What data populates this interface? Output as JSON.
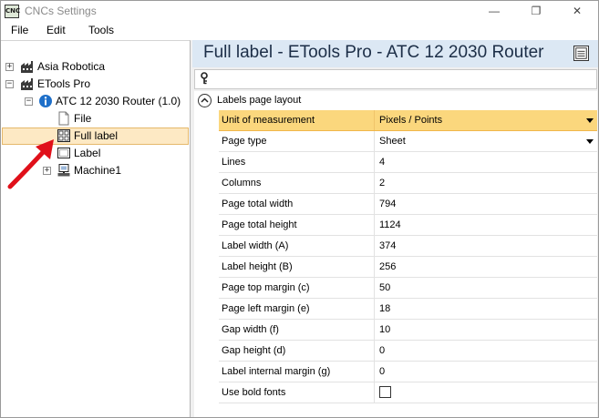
{
  "window": {
    "title": "CNCs Settings",
    "app_icon_text": "CNC",
    "minimize": "—",
    "maximize": "❐",
    "close": "✕"
  },
  "menu": [
    "File",
    "Edit",
    "Tools"
  ],
  "tree": {
    "nodes": [
      {
        "label": "Asia Robotica",
        "expander": "+",
        "icon": "factory-icon"
      },
      {
        "label": "ETools Pro",
        "expander": "−",
        "icon": "factory-icon"
      },
      {
        "label": "ATC 12 2030 Router (1.0)",
        "expander": "−",
        "icon": "router-info-icon"
      },
      {
        "label": "File",
        "icon": "file-icon"
      },
      {
        "label": "Full label",
        "icon": "full-label-icon",
        "selected": true
      },
      {
        "label": "Label",
        "icon": "label-icon"
      },
      {
        "label": "Machine1",
        "expander": "+",
        "icon": "machine-icon"
      }
    ]
  },
  "header": {
    "title": "Full label - ETools Pro - ATC 12 2030 Router"
  },
  "grid": {
    "category": "Labels page layout",
    "properties": [
      {
        "name": "Unit of measurement",
        "value": "Pixels / Points",
        "dropdown": true,
        "selected": true
      },
      {
        "name": "Page type",
        "value": "Sheet",
        "dropdown": true
      },
      {
        "name": "Lines",
        "value": "4"
      },
      {
        "name": "Columns",
        "value": "2"
      },
      {
        "name": "Page total width",
        "value": "794"
      },
      {
        "name": "Page total height",
        "value": "1124"
      },
      {
        "name": "Label width (A)",
        "value": "374"
      },
      {
        "name": "Label height (B)",
        "value": "256"
      },
      {
        "name": "Page top margin (c)",
        "value": "50"
      },
      {
        "name": "Page left margin (e)",
        "value": "18"
      },
      {
        "name": "Gap width (f)",
        "value": "10"
      },
      {
        "name": "Gap height (d)",
        "value": "0"
      },
      {
        "name": "Label internal margin (g)",
        "value": "0"
      },
      {
        "name": "Use bold fonts",
        "value": "",
        "checkbox": true,
        "checked": false
      }
    ]
  },
  "colors": {
    "header_bg": "#dce8f4",
    "selected_row": "#fbd77d",
    "tree_selected": "#fde9c4",
    "annotation_arrow": "#e0101a"
  }
}
